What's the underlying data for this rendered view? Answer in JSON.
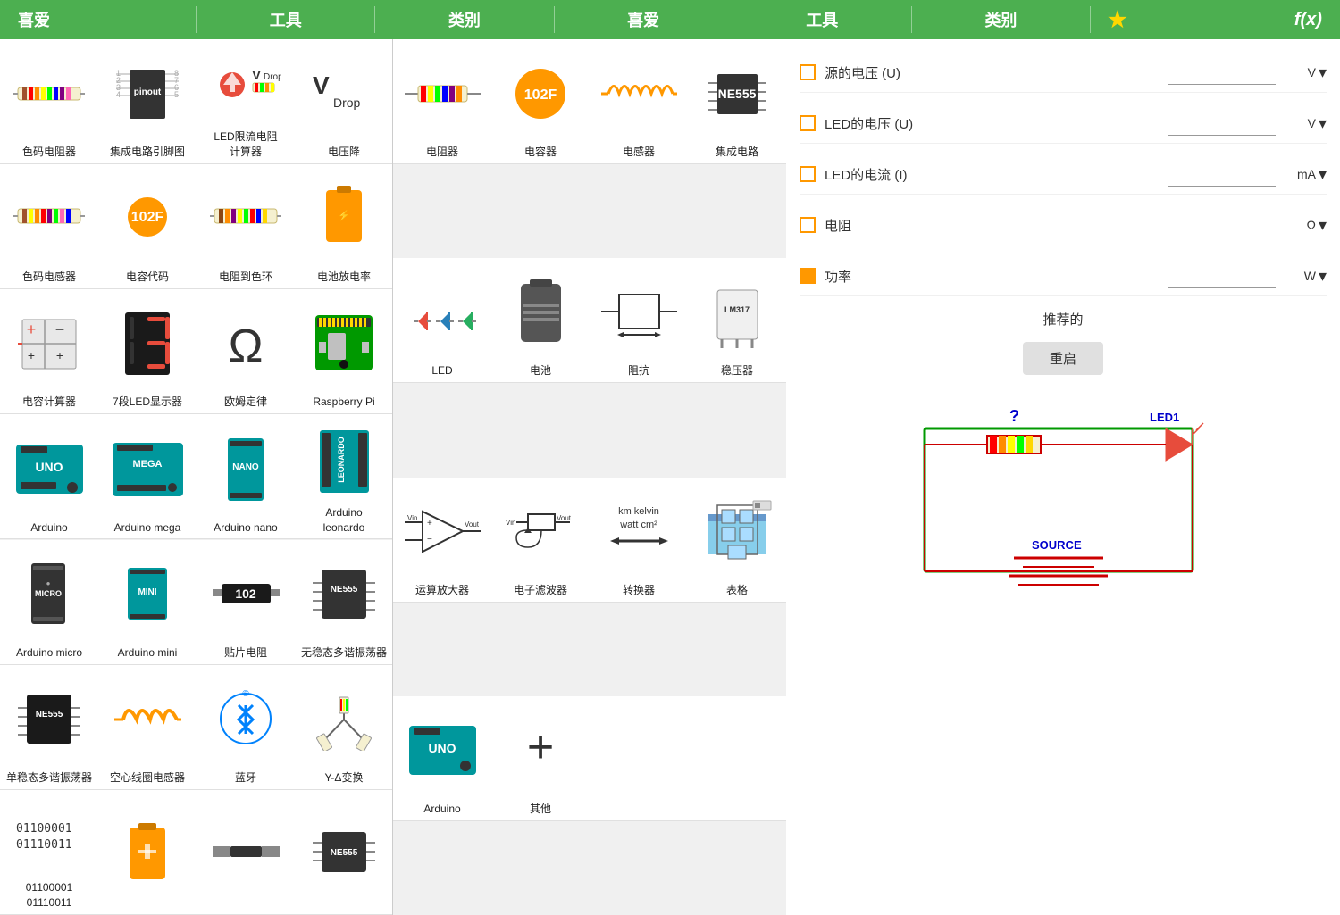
{
  "header": {
    "left_label": "喜爱",
    "tool_label": "工具",
    "category_label": "类别",
    "right_fav_label": "喜爱",
    "right_tool_label": "工具",
    "right_cat_label": "类别",
    "fx_label": "f(x)"
  },
  "left_items": [
    {
      "id": "color-resistor",
      "label": "色码电阻器",
      "icon": "resistor"
    },
    {
      "id": "ic-pinout",
      "label": "集成电路引脚图",
      "icon": "ic-pinout"
    },
    {
      "id": "led-resistor-calc",
      "label": "LED限流电阻\n计算器",
      "icon": "led-resistor"
    },
    {
      "id": "voltage-drop",
      "label": "电压降",
      "icon": "vdrop"
    },
    {
      "id": "color-inductor",
      "label": "色码电感器",
      "icon": "inductor"
    },
    {
      "id": "cap-code",
      "label": "电容代码",
      "icon": "cap-code"
    },
    {
      "id": "resistor-color",
      "label": "电阻到色环",
      "icon": "r-color"
    },
    {
      "id": "battery-rate",
      "label": "电池放电率",
      "icon": "battery"
    },
    {
      "id": "cap-calc",
      "label": "电容计算器",
      "icon": "cap-calc"
    },
    {
      "id": "7seg",
      "label": "7段LED显示器",
      "icon": "7seg"
    },
    {
      "id": "ohm",
      "label": "欧姆定律",
      "icon": "ohm"
    },
    {
      "id": "raspberry",
      "label": "Raspberry Pi",
      "icon": "raspberry"
    },
    {
      "id": "arduino",
      "label": "Arduino",
      "icon": "arduino"
    },
    {
      "id": "arduino-mega",
      "label": "Arduino mega",
      "icon": "arduino-mega"
    },
    {
      "id": "arduino-nano",
      "label": "Arduino nano",
      "icon": "arduino-nano"
    },
    {
      "id": "arduino-leonardo",
      "label": "Arduino\nleonardo",
      "icon": "arduino-leonardo"
    },
    {
      "id": "arduino-micro",
      "label": "Arduino micro",
      "icon": "arduino-micro"
    },
    {
      "id": "arduino-mini",
      "label": "Arduino mini",
      "icon": "arduino-mini"
    },
    {
      "id": "smd-resistor",
      "label": "贴片电阻",
      "icon": "smd"
    },
    {
      "id": "ne555-multi",
      "label": "无稳态多谐振荡器",
      "icon": "ne555-multi"
    },
    {
      "id": "ne555-mono",
      "label": "单稳态多谐振荡器",
      "icon": "ne555-mono"
    },
    {
      "id": "air-inductor",
      "label": "空心线圈电感器",
      "icon": "air-inductor"
    },
    {
      "id": "bluetooth",
      "label": "蓝牙",
      "icon": "bluetooth"
    },
    {
      "id": "ydelta",
      "label": "Y-Δ变换",
      "icon": "ydelta"
    },
    {
      "id": "binary",
      "label": "01100001\n01110011",
      "icon": "binary"
    }
  ],
  "right_items": [
    {
      "id": "resistor-r",
      "label": "电阻器",
      "icon": "resistor-r"
    },
    {
      "id": "capacitor-r",
      "label": "电容器",
      "icon": "capacitor-r"
    },
    {
      "id": "inductor-r",
      "label": "电感器",
      "icon": "inductor-r"
    },
    {
      "id": "ic-r",
      "label": "集成电路",
      "icon": "ic-r"
    },
    {
      "id": "led-r",
      "label": "LED",
      "icon": "led-r"
    },
    {
      "id": "battery-r",
      "label": "电池",
      "icon": "battery-r"
    },
    {
      "id": "impedance-r",
      "label": "阻抗",
      "icon": "impedance-r"
    },
    {
      "id": "regulator-r",
      "label": "稳压器",
      "icon": "regulator-r"
    },
    {
      "id": "opamp-r",
      "label": "运算放大器",
      "icon": "opamp-r"
    },
    {
      "id": "filter-r",
      "label": "电子滤波器",
      "icon": "filter-r"
    },
    {
      "id": "converter-r",
      "label": "转换器",
      "icon": "converter-r"
    },
    {
      "id": "table-r",
      "label": "表格",
      "icon": "table-r"
    },
    {
      "id": "arduino-r",
      "label": "Arduino",
      "icon": "arduino-r"
    },
    {
      "id": "other-r",
      "label": "其他",
      "icon": "other-r"
    }
  ],
  "props": {
    "title": "推荐的",
    "reset_label": "重启",
    "rows": [
      {
        "id": "source-v",
        "label": "源的电压 (U)",
        "checked": false,
        "value": "",
        "unit": "V"
      },
      {
        "id": "led-v",
        "label": "LED的电压 (U)",
        "checked": false,
        "value": "",
        "unit": "V"
      },
      {
        "id": "led-i",
        "label": "LED的电流 (I)",
        "checked": false,
        "value": "",
        "unit": "mA"
      },
      {
        "id": "resistance",
        "label": "电阻",
        "checked": false,
        "value": "",
        "unit": "Ω"
      },
      {
        "id": "power",
        "label": "功率",
        "checked": true,
        "value": "",
        "unit": "W"
      }
    ]
  },
  "circuit": {
    "led_label": "LED1",
    "source_label": "SOURCE",
    "question_label": "?"
  }
}
